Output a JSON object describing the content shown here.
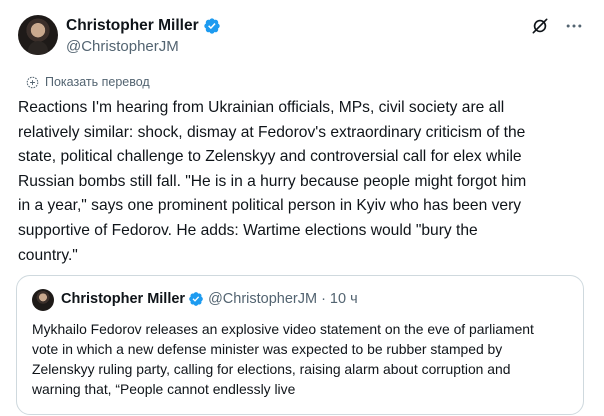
{
  "author": {
    "display_name": "Christopher Miller",
    "handle": "@ChristopherJM",
    "verified_color": "#1d9bf0"
  },
  "icons": {
    "top_right": [
      "grok-icon",
      "more-icon"
    ],
    "translate": "globe-icon"
  },
  "translate_label": "Показать перевод",
  "body_text": "Reactions I'm hearing from Ukrainian officials, MPs, civil society are all\nrelatively similar: shock, dismay at Fedorov's extraordinary criticism of the\nstate, political challenge to Zelenskyy and controversial call for elex while\nRussian bombs still fall. \"He is in a hurry because people might forgot him\nin a year,\" says one prominent political person in Kyiv who has been very\nsupportive of Fedorov. He adds: Wartime elections would \"bury the\ncountry.\"",
  "quote": {
    "display_name": "Christopher Miller",
    "handle": "@ChristopherJM",
    "separator": "·",
    "time": "10 ч",
    "text": "Mykhailo Fedorov releases an explosive video statement on the eve of parliament\nvote in which a new defense minister was expected to be rubber stamped by\nZelenskyy ruling party, calling for elections, raising alarm about corruption and\nwarning that, “People cannot endlessly live"
  }
}
